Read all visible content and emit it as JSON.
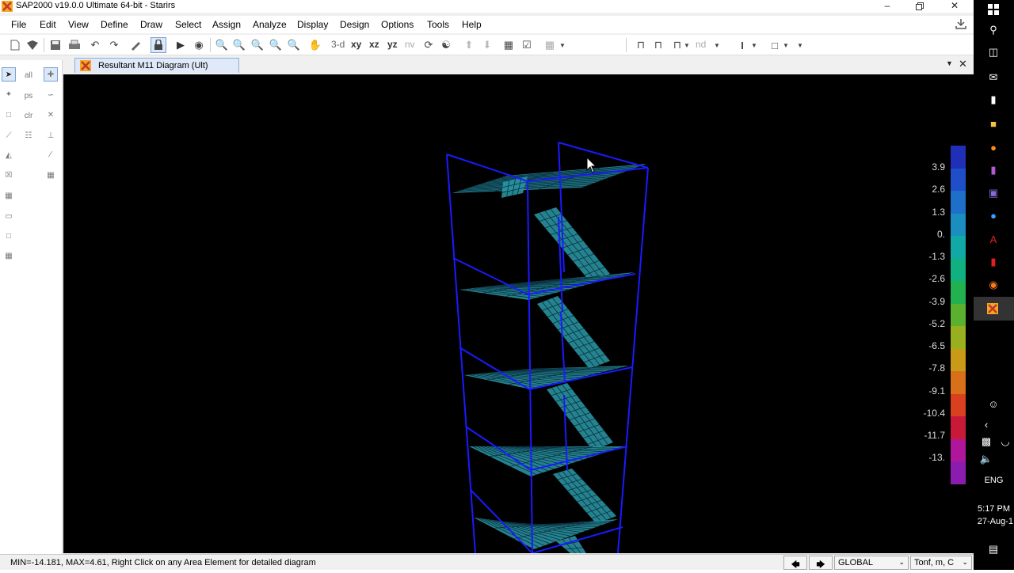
{
  "window": {
    "title": "SAP2000 v19.0.0 Ultimate 64-bit - Starirs",
    "minimize_icon": "minimize-icon",
    "restore_icon": "restore-icon",
    "close_icon": "close-icon"
  },
  "menu": [
    "File",
    "Edit",
    "View",
    "Define",
    "Draw",
    "Select",
    "Assign",
    "Analyze",
    "Display",
    "Design",
    "Options",
    "Tools",
    "Help"
  ],
  "toolbar": {
    "view_3d": "3-d",
    "view_xy": "xy",
    "view_xz": "xz",
    "view_yz": "yz",
    "view_nv": "nv",
    "nd": "nd"
  },
  "tab": {
    "label": "Resultant M11 Diagram  (Ult)"
  },
  "legend": {
    "labels": [
      "3.9",
      "2.6",
      "1.3",
      "0.",
      "-1.3",
      "-2.6",
      "-3.9",
      "-5.2",
      "-6.5",
      "-7.8",
      "-9.1",
      "-10.4",
      "-11.7",
      "-13."
    ],
    "colors": [
      "#1f2fb8",
      "#1f4fc8",
      "#1e6fc9",
      "#1a8fbf",
      "#12a8a6",
      "#10b080",
      "#22b050",
      "#5cb030",
      "#98b020",
      "#c89a18",
      "#d8701a",
      "#d84020",
      "#c81a38",
      "#b0169a",
      "#8a1cb0"
    ]
  },
  "status": {
    "message": "MIN=-14.181, MAX=4.61, Right Click on any Area Element for detailed diagram",
    "coord_system": "GLOBAL",
    "units": "Tonf, m, C"
  },
  "taskbar": {
    "language": "ENG",
    "time": "5:17 PM",
    "date": "27-Aug-1"
  },
  "colors": {
    "frame": "#1a1aff",
    "shell_fill": "#2a9aa8",
    "shell_grid": "#0a3040",
    "canvas": "#000000"
  }
}
